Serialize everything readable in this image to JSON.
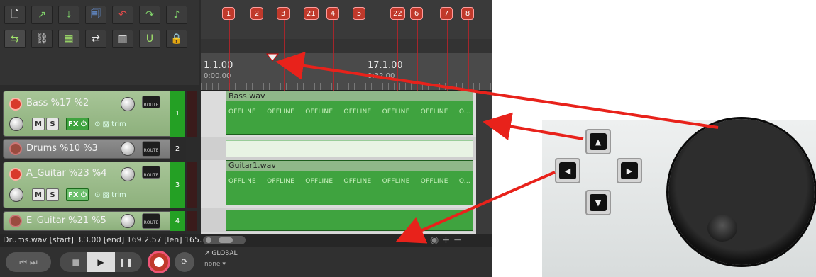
{
  "toolbar": {
    "row1": [
      {
        "icon": "new-project-icon",
        "glyph": "🗋"
      },
      {
        "icon": "open-project-icon",
        "glyph": "↗"
      },
      {
        "icon": "save-project-icon",
        "glyph": "💾"
      },
      {
        "icon": "project-tab-icon",
        "glyph": "🗐"
      },
      {
        "icon": "undo-icon",
        "glyph": "↶"
      },
      {
        "icon": "redo-icon",
        "glyph": "↷"
      },
      {
        "icon": "metronome-icon",
        "glyph": "♩"
      }
    ],
    "row2": [
      {
        "icon": "auto-crossfade-icon",
        "glyph": "⇆"
      },
      {
        "icon": "ripple-edit-icon",
        "glyph": "⛓"
      },
      {
        "icon": "item-grouping-icon",
        "glyph": "▦"
      },
      {
        "icon": "envelope-points-icon",
        "glyph": "⇄"
      },
      {
        "icon": "grid-icon",
        "glyph": "▥"
      },
      {
        "icon": "snap-icon",
        "glyph": "U"
      },
      {
        "icon": "lock-icon",
        "glyph": "🔒"
      }
    ]
  },
  "markers": [
    {
      "label": "1"
    },
    {
      "label": "2"
    },
    {
      "label": "3"
    },
    {
      "label": "21"
    },
    {
      "label": "4"
    },
    {
      "label": "5"
    },
    {
      "label": "22"
    },
    {
      "label": "6"
    },
    {
      "label": "7"
    },
    {
      "label": "8"
    }
  ],
  "timeline": {
    "pos1_bar": "1.1.00",
    "pos1_time": "0:00.00",
    "pos2_bar": "17.1.00",
    "pos2_time": "0:32.00"
  },
  "tracks": [
    {
      "name": "Bass %17 %2",
      "number": "1",
      "item": "Bass.wav",
      "offline": [
        "OFFLINE",
        "OFFLINE",
        "OFFLINE",
        "OFFLINE",
        "OFFLINE",
        "OFFLINE",
        "O..."
      ]
    },
    {
      "name": "Drums %10 %3",
      "number": "2"
    },
    {
      "name": "A_Guitar %23 %4",
      "number": "3",
      "item": "Guitar1.wav",
      "offline": [
        "OFFLINE",
        "OFFLINE",
        "OFFLINE",
        "OFFLINE",
        "OFFLINE",
        "OFFLINE",
        "O..."
      ]
    },
    {
      "name": "E_Guitar %21 %5",
      "number": "4"
    }
  ],
  "track_buttons": {
    "mute": "M",
    "solo": "S",
    "fx": "FX",
    "trim": "trim",
    "route": "ROUTE"
  },
  "status_text": "Drums.wav [start] 3.3.00 [end] 169.2.57 [len] 165.",
  "transport": {
    "global_label": "GLOBAL",
    "global_value": "none"
  },
  "colors": {
    "accent_red": "#e8221b",
    "track_green": "#3fa33f",
    "record_red": "#d83a2b"
  }
}
